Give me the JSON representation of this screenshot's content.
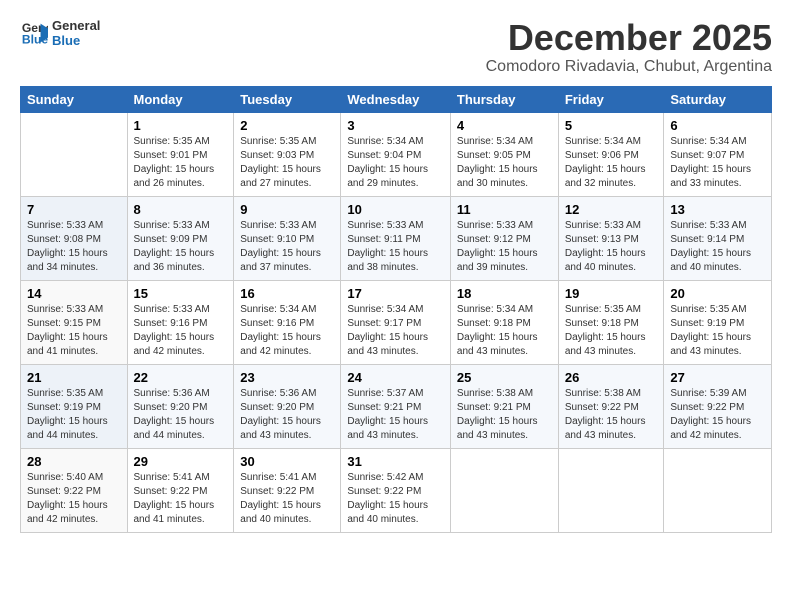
{
  "logo": {
    "line1": "General",
    "line2": "Blue"
  },
  "title": "December 2025",
  "subtitle": "Comodoro Rivadavia, Chubut, Argentina",
  "days_of_week": [
    "Sunday",
    "Monday",
    "Tuesday",
    "Wednesday",
    "Thursday",
    "Friday",
    "Saturday"
  ],
  "weeks": [
    [
      {
        "day": "",
        "info": ""
      },
      {
        "day": "1",
        "info": "Sunrise: 5:35 AM\nSunset: 9:01 PM\nDaylight: 15 hours\nand 26 minutes."
      },
      {
        "day": "2",
        "info": "Sunrise: 5:35 AM\nSunset: 9:03 PM\nDaylight: 15 hours\nand 27 minutes."
      },
      {
        "day": "3",
        "info": "Sunrise: 5:34 AM\nSunset: 9:04 PM\nDaylight: 15 hours\nand 29 minutes."
      },
      {
        "day": "4",
        "info": "Sunrise: 5:34 AM\nSunset: 9:05 PM\nDaylight: 15 hours\nand 30 minutes."
      },
      {
        "day": "5",
        "info": "Sunrise: 5:34 AM\nSunset: 9:06 PM\nDaylight: 15 hours\nand 32 minutes."
      },
      {
        "day": "6",
        "info": "Sunrise: 5:34 AM\nSunset: 9:07 PM\nDaylight: 15 hours\nand 33 minutes."
      }
    ],
    [
      {
        "day": "7",
        "info": "Sunrise: 5:33 AM\nSunset: 9:08 PM\nDaylight: 15 hours\nand 34 minutes."
      },
      {
        "day": "8",
        "info": "Sunrise: 5:33 AM\nSunset: 9:09 PM\nDaylight: 15 hours\nand 36 minutes."
      },
      {
        "day": "9",
        "info": "Sunrise: 5:33 AM\nSunset: 9:10 PM\nDaylight: 15 hours\nand 37 minutes."
      },
      {
        "day": "10",
        "info": "Sunrise: 5:33 AM\nSunset: 9:11 PM\nDaylight: 15 hours\nand 38 minutes."
      },
      {
        "day": "11",
        "info": "Sunrise: 5:33 AM\nSunset: 9:12 PM\nDaylight: 15 hours\nand 39 minutes."
      },
      {
        "day": "12",
        "info": "Sunrise: 5:33 AM\nSunset: 9:13 PM\nDaylight: 15 hours\nand 40 minutes."
      },
      {
        "day": "13",
        "info": "Sunrise: 5:33 AM\nSunset: 9:14 PM\nDaylight: 15 hours\nand 40 minutes."
      }
    ],
    [
      {
        "day": "14",
        "info": "Sunrise: 5:33 AM\nSunset: 9:15 PM\nDaylight: 15 hours\nand 41 minutes."
      },
      {
        "day": "15",
        "info": "Sunrise: 5:33 AM\nSunset: 9:16 PM\nDaylight: 15 hours\nand 42 minutes."
      },
      {
        "day": "16",
        "info": "Sunrise: 5:34 AM\nSunset: 9:16 PM\nDaylight: 15 hours\nand 42 minutes."
      },
      {
        "day": "17",
        "info": "Sunrise: 5:34 AM\nSunset: 9:17 PM\nDaylight: 15 hours\nand 43 minutes."
      },
      {
        "day": "18",
        "info": "Sunrise: 5:34 AM\nSunset: 9:18 PM\nDaylight: 15 hours\nand 43 minutes."
      },
      {
        "day": "19",
        "info": "Sunrise: 5:35 AM\nSunset: 9:18 PM\nDaylight: 15 hours\nand 43 minutes."
      },
      {
        "day": "20",
        "info": "Sunrise: 5:35 AM\nSunset: 9:19 PM\nDaylight: 15 hours\nand 43 minutes."
      }
    ],
    [
      {
        "day": "21",
        "info": "Sunrise: 5:35 AM\nSunset: 9:19 PM\nDaylight: 15 hours\nand 44 minutes."
      },
      {
        "day": "22",
        "info": "Sunrise: 5:36 AM\nSunset: 9:20 PM\nDaylight: 15 hours\nand 44 minutes."
      },
      {
        "day": "23",
        "info": "Sunrise: 5:36 AM\nSunset: 9:20 PM\nDaylight: 15 hours\nand 43 minutes."
      },
      {
        "day": "24",
        "info": "Sunrise: 5:37 AM\nSunset: 9:21 PM\nDaylight: 15 hours\nand 43 minutes."
      },
      {
        "day": "25",
        "info": "Sunrise: 5:38 AM\nSunset: 9:21 PM\nDaylight: 15 hours\nand 43 minutes."
      },
      {
        "day": "26",
        "info": "Sunrise: 5:38 AM\nSunset: 9:22 PM\nDaylight: 15 hours\nand 43 minutes."
      },
      {
        "day": "27",
        "info": "Sunrise: 5:39 AM\nSunset: 9:22 PM\nDaylight: 15 hours\nand 42 minutes."
      }
    ],
    [
      {
        "day": "28",
        "info": "Sunrise: 5:40 AM\nSunset: 9:22 PM\nDaylight: 15 hours\nand 42 minutes."
      },
      {
        "day": "29",
        "info": "Sunrise: 5:41 AM\nSunset: 9:22 PM\nDaylight: 15 hours\nand 41 minutes."
      },
      {
        "day": "30",
        "info": "Sunrise: 5:41 AM\nSunset: 9:22 PM\nDaylight: 15 hours\nand 40 minutes."
      },
      {
        "day": "31",
        "info": "Sunrise: 5:42 AM\nSunset: 9:22 PM\nDaylight: 15 hours\nand 40 minutes."
      },
      {
        "day": "",
        "info": ""
      },
      {
        "day": "",
        "info": ""
      },
      {
        "day": "",
        "info": ""
      }
    ]
  ]
}
